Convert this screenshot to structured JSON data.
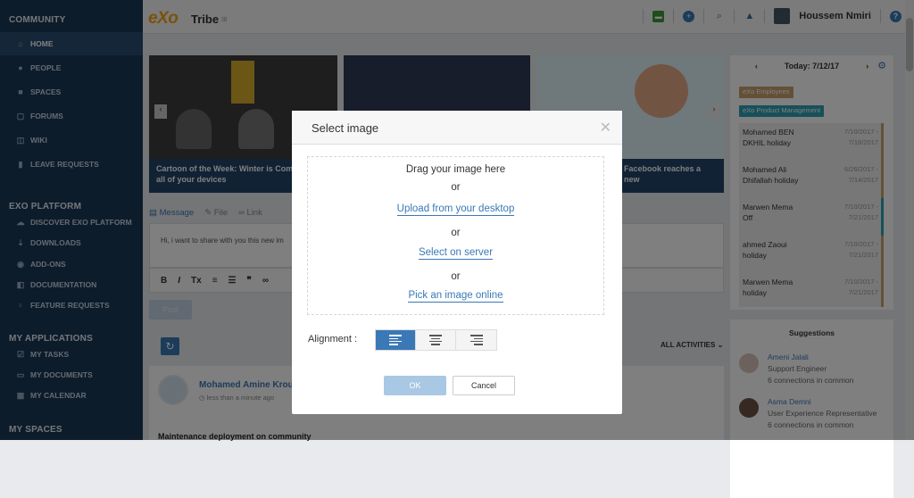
{
  "sidebar": {
    "community_title": "COMMUNITY",
    "community_items": [
      {
        "label": "HOME",
        "icon": "home-icon"
      },
      {
        "label": "PEOPLE",
        "icon": "people-icon"
      },
      {
        "label": "SPACES",
        "icon": "spaces-icon"
      },
      {
        "label": "FORUMS",
        "icon": "forums-icon"
      },
      {
        "label": "WIKI",
        "icon": "wiki-icon"
      },
      {
        "label": "LEAVE REQUESTS",
        "icon": "document-icon"
      }
    ],
    "platform_title": "EXO PLATFORM",
    "platform_items": [
      {
        "label": "DISCOVER EXO PLATFORM"
      },
      {
        "label": "DOWNLOADS"
      },
      {
        "label": "ADD-ONS"
      },
      {
        "label": "DOCUMENTATION"
      },
      {
        "label": "FEATURE REQUESTS"
      }
    ],
    "apps_title": "MY APPLICATIONS",
    "apps_items": [
      {
        "label": "MY TASKS"
      },
      {
        "label": "MY DOCUMENTS"
      },
      {
        "label": "MY CALENDAR"
      }
    ],
    "spaces_title": "MY SPACES"
  },
  "topbar": {
    "logo": "eXo",
    "site_name": "Tribe",
    "user_name": "Houssem Nmiri",
    "help": "?"
  },
  "carousel": {
    "card1_caption": "Cartoon of the Week: Winter is Coming... to all of your devices",
    "card3_caption": "Facebook reaches a new"
  },
  "composer": {
    "tab_message": "Message",
    "tab_file": "File",
    "tab_link": "Link",
    "text": "Hi, i want to share with you this new im",
    "post_label": "Post"
  },
  "activity": {
    "filter": "ALL ACTIVITIES",
    "author": "Mohamed Amine Krout",
    "time": "less than a minute ago",
    "body": "Maintenance deployment on community"
  },
  "calendar": {
    "date": "Today: 7/12/17",
    "tag1": "eXo Employees",
    "tag2": "eXo Product Management",
    "events": [
      {
        "name1": "Mohamed BEN",
        "name2": "DKHIL holiday",
        "d1": "7/10/2017 -",
        "d2": "7/18/2017"
      },
      {
        "name1": "Mohamed Ali",
        "name2": "Dhifallah holiday",
        "d1": "6/26/2017 -",
        "d2": "7/14/2017"
      },
      {
        "name1": "Marwen Mema",
        "name2": "Off",
        "d1": "7/10/2017 -",
        "d2": "7/21/2017"
      },
      {
        "name1": "ahmed Zaoui",
        "name2": "holiday",
        "d1": "7/10/2017 -",
        "d2": "7/21/2017"
      },
      {
        "name1": "Marwen Mema",
        "name2": "holiday",
        "d1": "7/10/2017 -",
        "d2": "7/21/2017"
      }
    ]
  },
  "suggestions": {
    "title": "Suggestions",
    "people": [
      {
        "name": "Ameni Jalali",
        "role": "Support Engineer",
        "common": "6 connections in common"
      },
      {
        "name": "Asma Demni",
        "role": "User Experience Representative",
        "common": "6 connections in common"
      }
    ]
  },
  "modal": {
    "title": "Select image",
    "drag_text": "Drag your image here",
    "or1": "or",
    "upload_link": "Upload from your desktop",
    "or2": "or",
    "server_link": "Select on server",
    "or3": "or",
    "online_link": "Pick an image online",
    "alignment_label": "Alignment :",
    "ok_label": "OK",
    "cancel_label": "Cancel"
  },
  "colors": {
    "sidebar_bg": "#1a3856",
    "accent": "#3a78b6",
    "logo": "#f2a417"
  }
}
